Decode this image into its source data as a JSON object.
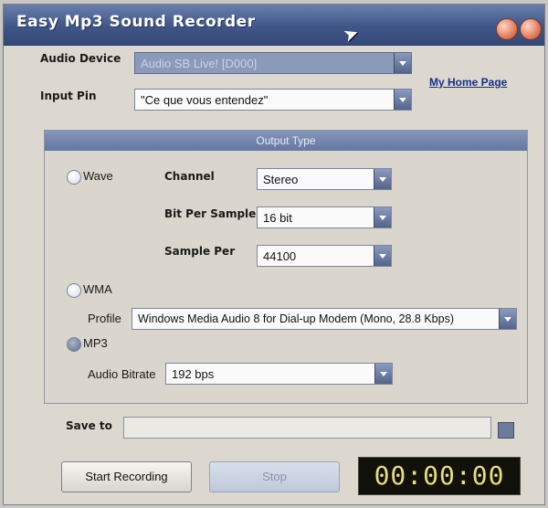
{
  "window": {
    "title": "Easy Mp3 Sound Recorder"
  },
  "audio_device": {
    "label": "Audio Device",
    "value": "Audio SB Live! [D000]"
  },
  "input_pin": {
    "label": "Input Pin",
    "value": "\"Ce que vous entendez\""
  },
  "home_link": "My Home Page",
  "output_type": {
    "header": "Output Type",
    "wave": {
      "label": "Wave",
      "channel_label": "Channel",
      "channel_value": "Stereo",
      "bits_label": "Bit Per Sample",
      "bits_value": "16 bit",
      "rate_label": "Sample Per",
      "rate_value": "44100"
    },
    "wma": {
      "label": "WMA",
      "profile_label": "Profile",
      "profile_value": "Windows Media Audio 8 for Dial-up Modem (Mono, 28.8 Kbps)"
    },
    "mp3": {
      "label": "MP3",
      "bitrate_label": "Audio Bitrate",
      "bitrate_value": "192 bps"
    },
    "selected": "MP3"
  },
  "save_to": {
    "label": "Save to",
    "value": ""
  },
  "buttons": {
    "start": "Start Recording",
    "stop": "Stop"
  },
  "timer": "00:00:00"
}
